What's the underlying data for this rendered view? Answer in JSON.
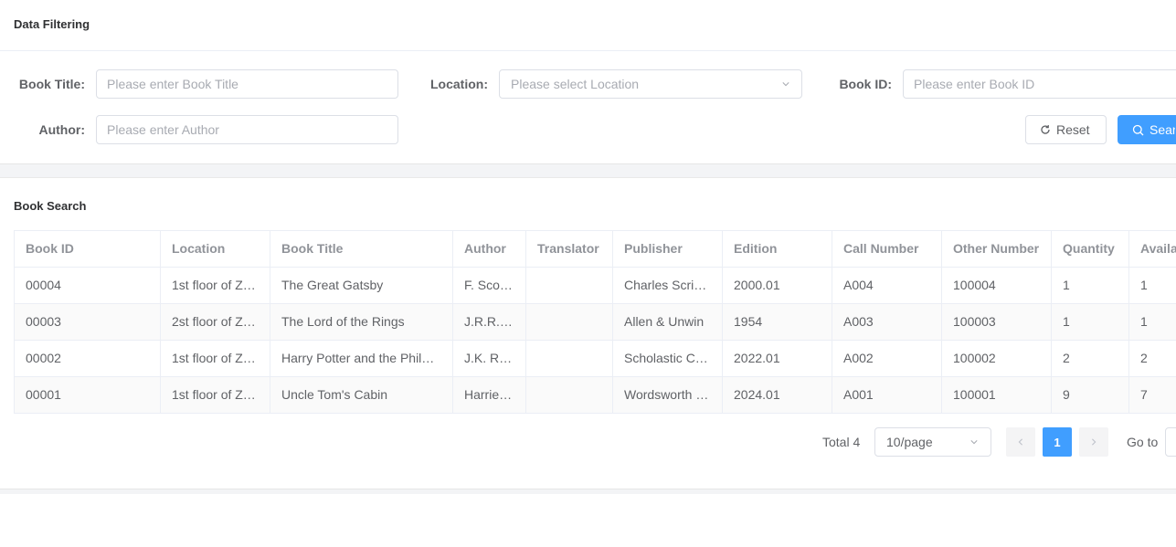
{
  "filter": {
    "title": "Data Filtering",
    "book_title": {
      "label": "Book Title:",
      "placeholder": "Please enter Book Title"
    },
    "location": {
      "label": "Location:",
      "placeholder": "Please select Location"
    },
    "book_id": {
      "label": "Book ID:",
      "placeholder": "Please enter Book ID"
    },
    "author": {
      "label": "Author:",
      "placeholder": "Please enter Author"
    },
    "reset_label": "Reset",
    "search_label": "Search"
  },
  "results": {
    "title": "Book Search",
    "columns": [
      "Book ID",
      "Location",
      "Book Title",
      "Author",
      "Translator",
      "Publisher",
      "Edition",
      "Call Number",
      "Other Number",
      "Quantity",
      "Available"
    ],
    "rows": [
      [
        "00004",
        "1st floor of Z…",
        "The Great Gatsby",
        "F. Sco…",
        "",
        "Charles Scri…",
        "2000.01",
        "A004",
        "100004",
        "1",
        "1"
      ],
      [
        "00003",
        "2st floor of Z…",
        "The Lord of the Rings",
        "J.R.R.…",
        "",
        "Allen & Unwin",
        "1954",
        "A003",
        "100003",
        "1",
        "1"
      ],
      [
        "00002",
        "1st floor of Z…",
        "Harry Potter and the Phil…",
        "J.K. R…",
        "",
        "Scholastic C…",
        "2022.01",
        "A002",
        "100002",
        "2",
        "2"
      ],
      [
        "00001",
        "1st floor of Z…",
        "Uncle Tom's Cabin",
        "Harrie…",
        "",
        "Wordsworth …",
        "2024.01",
        "A001",
        "100001",
        "9",
        "7"
      ]
    ]
  },
  "pagination": {
    "total_label": "Total 4",
    "page_size": "10/page",
    "current_page": "1",
    "goto_label": "Go to"
  },
  "colors": {
    "accent": "#409eff",
    "border": "#dcdfe6",
    "placeholder": "#a8abb2"
  }
}
